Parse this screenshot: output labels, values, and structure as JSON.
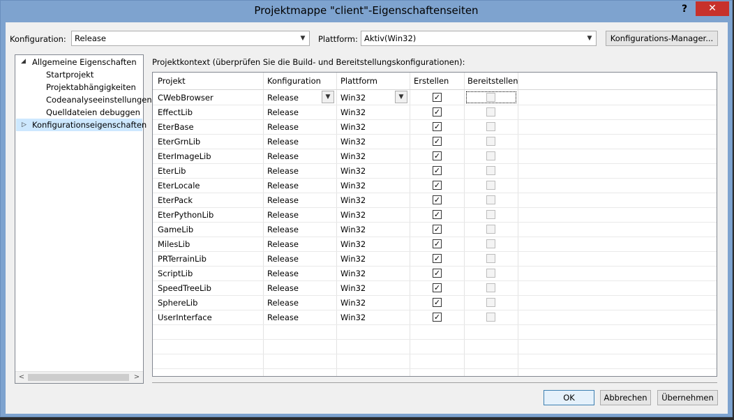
{
  "window": {
    "title": "Projektmappe \"client\"-Eigenschaftenseiten",
    "help": "?",
    "close": "✕"
  },
  "toolbar": {
    "config_label": "Konfiguration:",
    "config_value": "Release",
    "platform_label": "Plattform:",
    "platform_value": "Aktiv(Win32)",
    "config_manager_label": "Konfigurations-Manager..."
  },
  "tree": {
    "items": [
      {
        "label": "Allgemeine Eigenschaften",
        "toggle": "◢"
      },
      {
        "label": "Startprojekt"
      },
      {
        "label": "Projektabhängigkeiten"
      },
      {
        "label": "Codeanalyseeinstellungen"
      },
      {
        "label": "Quelldateien debuggen"
      },
      {
        "label": "Konfigurationseigenschaften",
        "toggle": "▷"
      }
    ],
    "scroll_left": "<",
    "scroll_right": ">"
  },
  "context_label": "Projektkontext (überprüfen Sie die Build- und Bereitstellungskonfigurationen):",
  "grid": {
    "headers": [
      "Projekt",
      "Konfiguration",
      "Plattform",
      "Erstellen",
      "Bereitstellen"
    ],
    "rows": [
      {
        "project": "CWebBrowser",
        "config": "Release",
        "platform": "Win32",
        "build": true,
        "deploy": false
      },
      {
        "project": "EffectLib",
        "config": "Release",
        "platform": "Win32",
        "build": true,
        "deploy": false
      },
      {
        "project": "EterBase",
        "config": "Release",
        "platform": "Win32",
        "build": true,
        "deploy": false
      },
      {
        "project": "EterGrnLib",
        "config": "Release",
        "platform": "Win32",
        "build": true,
        "deploy": false
      },
      {
        "project": "EterImageLib",
        "config": "Release",
        "platform": "Win32",
        "build": true,
        "deploy": false
      },
      {
        "project": "EterLib",
        "config": "Release",
        "platform": "Win32",
        "build": true,
        "deploy": false
      },
      {
        "project": "EterLocale",
        "config": "Release",
        "platform": "Win32",
        "build": true,
        "deploy": false
      },
      {
        "project": "EterPack",
        "config": "Release",
        "platform": "Win32",
        "build": true,
        "deploy": false
      },
      {
        "project": "EterPythonLib",
        "config": "Release",
        "platform": "Win32",
        "build": true,
        "deploy": false
      },
      {
        "project": "GameLib",
        "config": "Release",
        "platform": "Win32",
        "build": true,
        "deploy": false
      },
      {
        "project": "MilesLib",
        "config": "Release",
        "platform": "Win32",
        "build": true,
        "deploy": false
      },
      {
        "project": "PRTerrainLib",
        "config": "Release",
        "platform": "Win32",
        "build": true,
        "deploy": false
      },
      {
        "project": "ScriptLib",
        "config": "Release",
        "platform": "Win32",
        "build": true,
        "deploy": false
      },
      {
        "project": "SpeedTreeLib",
        "config": "Release",
        "platform": "Win32",
        "build": true,
        "deploy": false
      },
      {
        "project": "SphereLib",
        "config": "Release",
        "platform": "Win32",
        "build": true,
        "deploy": false
      },
      {
        "project": "UserInterface",
        "config": "Release",
        "platform": "Win32",
        "build": true,
        "deploy": false
      }
    ],
    "check_mark": "✓"
  },
  "buttons": {
    "ok": "OK",
    "cancel": "Abbrechen",
    "apply": "Übernehmen"
  }
}
